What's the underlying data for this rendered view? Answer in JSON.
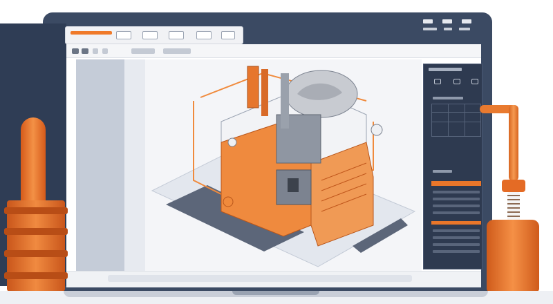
{
  "window": {
    "title": "",
    "tabs": []
  },
  "toolbar": {
    "buttons": [
      "",
      "",
      "",
      ""
    ]
  },
  "right_panel": {
    "title": "",
    "sections": []
  },
  "colors": {
    "accent": "#f07a2a",
    "frame": "#3b4a63",
    "panel": "#2e3a50",
    "sidebar": "#c5ccd8",
    "canvas": "#f4f5f8"
  },
  "icons": {
    "tab_icons": [
      "document-icon",
      "image-icon",
      "layers-icon",
      "shapes-icon"
    ],
    "panel_icons": [
      "rotate-icon",
      "grid-icon",
      "eye-icon"
    ],
    "window_controls": [
      "minimize-icon",
      "maximize-icon",
      "close-icon"
    ]
  },
  "illustration": {
    "subject": "machine-3d-model"
  }
}
